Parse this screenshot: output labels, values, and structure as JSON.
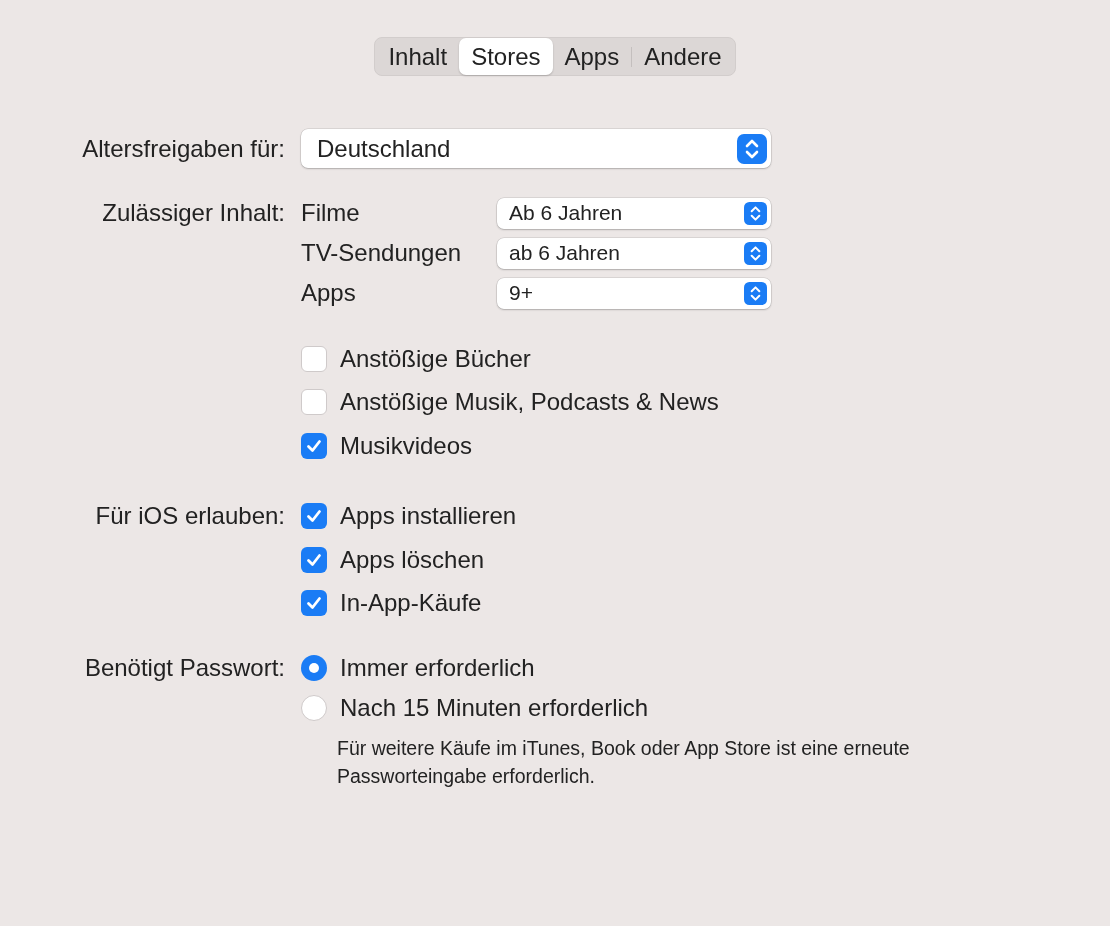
{
  "tabs": [
    {
      "label": "Inhalt",
      "selected": false
    },
    {
      "label": "Stores",
      "selected": true
    },
    {
      "label": "Apps",
      "selected": false
    },
    {
      "label": "Andere",
      "selected": false
    }
  ],
  "sections": [
    {
      "kind": "popup",
      "label": "Altersfreigaben für:",
      "value": "Deutschland"
    },
    {
      "kind": "ratings",
      "label": "Zulässiger Inhalt:",
      "items": [
        {
          "label": "Filme",
          "value": "Ab 6 Jahren"
        },
        {
          "label": "TV-Sendungen",
          "value": "ab 6 Jahren"
        },
        {
          "label": "Apps",
          "value": "9+"
        }
      ]
    },
    {
      "kind": "checkboxes",
      "items": [
        {
          "label": "Anstößige Bücher",
          "checked": false
        },
        {
          "label": "Anstößige Musik, Podcasts & News",
          "checked": false
        },
        {
          "label": "Musikvideos",
          "checked": true
        }
      ]
    },
    {
      "kind": "checkboxes",
      "label": "Für iOS erlauben:",
      "items": [
        {
          "label": "Apps installieren",
          "checked": true
        },
        {
          "label": "Apps löschen",
          "checked": true
        },
        {
          "label": "In-App-Käufe",
          "checked": true
        }
      ]
    },
    {
      "kind": "radios",
      "label": "Benötigt Passwort:",
      "items": [
        {
          "label": "Immer erforderlich",
          "selected": true
        },
        {
          "label": "Nach 15 Minuten erforderlich",
          "selected": false
        }
      ],
      "note": "Für weitere Käufe im iTunes, Book oder App Store ist eine erneute Passworteingabe erforderlich."
    }
  ]
}
